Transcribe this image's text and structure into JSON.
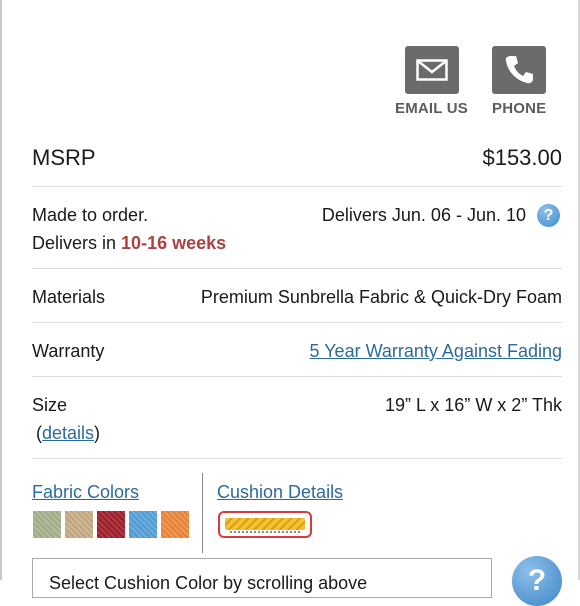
{
  "contact": {
    "email_label": "EMAIL US",
    "phone_label": "PHONE"
  },
  "msrp": {
    "label": "MSRP",
    "price": "$153.00"
  },
  "delivery": {
    "made_to_order": "Made to order.",
    "delivers_in_prefix": "Delivers in",
    "delivers_in_weeks": "10-16 weeks",
    "delivers_dates": "Delivers Jun. 06 - Jun. 10",
    "help_glyph": "?"
  },
  "materials": {
    "label": "Materials",
    "value": "Premium Sunbrella Fabric & Quick-Dry Foam"
  },
  "warranty": {
    "label": "Warranty",
    "link": "5 Year Warranty Against Fading"
  },
  "size": {
    "label": "Size",
    "open_paren": "(",
    "details_link": "details",
    "close_paren": ")",
    "value": "19” L x 16” W x 2” Thk"
  },
  "fabric_colors": {
    "link": "Fabric Colors",
    "swatches": [
      {
        "name": "sage",
        "color": "#a9b48e"
      },
      {
        "name": "wheat",
        "color": "#c8ae85"
      },
      {
        "name": "burgundy",
        "color": "#a3202c"
      },
      {
        "name": "sky-blue",
        "color": "#58a3dc"
      },
      {
        "name": "orange",
        "color": "#f08a3e"
      }
    ]
  },
  "cushion_details": {
    "link": "Cushion Details"
  },
  "select": {
    "text": "Select Cushion Color by scrolling above"
  },
  "colors": {
    "link": "#2b6aa0",
    "accent_red": "#b04040",
    "icon_gray": "#6b6b6b"
  }
}
